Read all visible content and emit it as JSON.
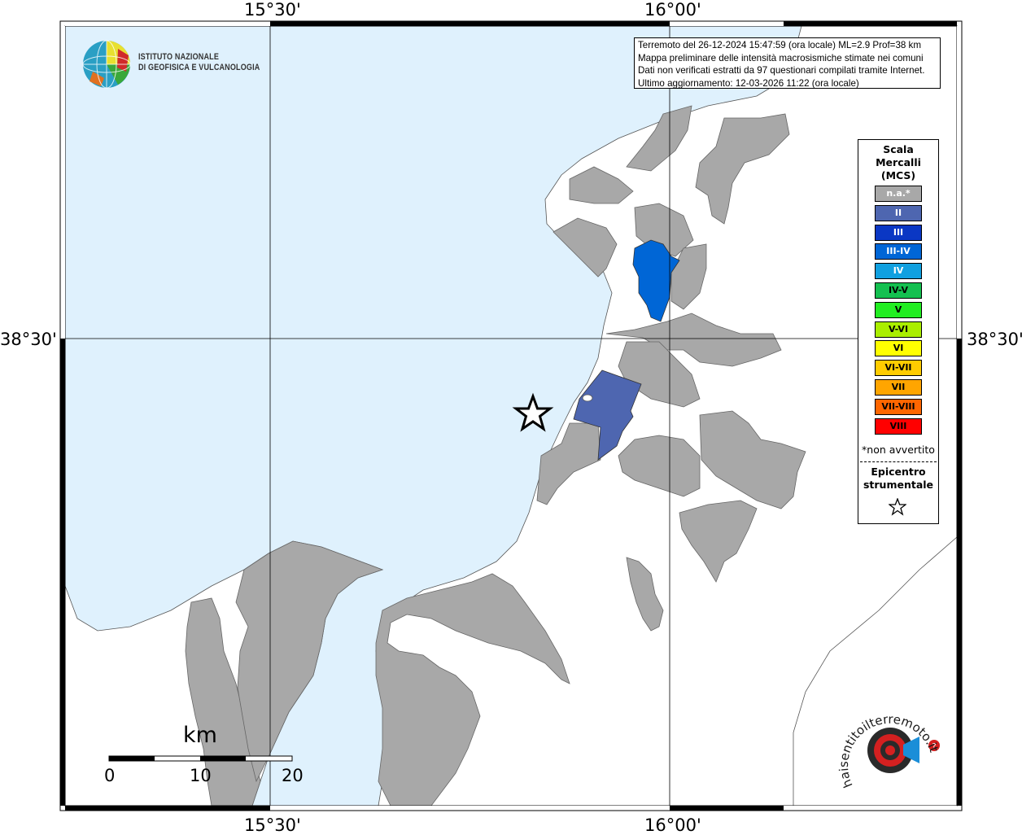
{
  "map": {
    "longitude_ticks": [
      "15°30'",
      "16°00'"
    ],
    "latitude_ticks": [
      "38°30'"
    ],
    "colors": {
      "sea": "#dff1fd",
      "land_unsurveyed": "#ffffff",
      "municipality_na": "#a8a8a8",
      "intensity_II": "#4e66b0",
      "intensity_III_IV": "#0066d6"
    }
  },
  "logo": {
    "line1": "ISTITUTO NAZIONALE",
    "line2": "DI GEOFISICA E VULCANOLOGIA"
  },
  "info_box": {
    "line1": "Terremoto del 26-12-2024 15:47:59 (ora locale) ML=2.9 Prof=38 km",
    "line2": "Mappa preliminare delle intensità macrosismiche stimate nei comuni",
    "line3": "Dati non verificati estratti da 97 questionari compilati tramite Internet.",
    "line4": "Ultimo aggiornamento: 12-03-2026 11:22 (ora locale)"
  },
  "legend": {
    "title1": "Scala",
    "title2": "Mercalli",
    "title3": "(MCS)",
    "items": [
      {
        "label": "n.a.*",
        "color": "#a8a8a8",
        "text": "#ffffff"
      },
      {
        "label": "II",
        "color": "#4e66b0",
        "text": "#ffffff"
      },
      {
        "label": "III",
        "color": "#0a37c4",
        "text": "#ffffff"
      },
      {
        "label": "III-IV",
        "color": "#0066d6",
        "text": "#ffffff"
      },
      {
        "label": "IV",
        "color": "#10a0e0",
        "text": "#ffffff"
      },
      {
        "label": "IV-V",
        "color": "#14c050",
        "text": "#000000"
      },
      {
        "label": "V",
        "color": "#22ee22",
        "text": "#000000"
      },
      {
        "label": "V-VI",
        "color": "#aaee00",
        "text": "#000000"
      },
      {
        "label": "VI",
        "color": "#ffff00",
        "text": "#000000"
      },
      {
        "label": "VI-VII",
        "color": "#ffcc00",
        "text": "#000000"
      },
      {
        "label": "VII",
        "color": "#ffa500",
        "text": "#000000"
      },
      {
        "label": "VII-VIII",
        "color": "#ff6600",
        "text": "#000000"
      },
      {
        "label": "VIII",
        "color": "#ff0000",
        "text": "#000000"
      }
    ],
    "note": "*non avvertito",
    "epicenter1": "Epicentro",
    "epicenter2": "strumentale",
    "star": "☆"
  },
  "scale_bar": {
    "unit": "km",
    "labels": [
      "0",
      "10",
      "20"
    ]
  },
  "hst_logo": {
    "text": "haisentitoilterremoto.it",
    "alt": "www."
  }
}
